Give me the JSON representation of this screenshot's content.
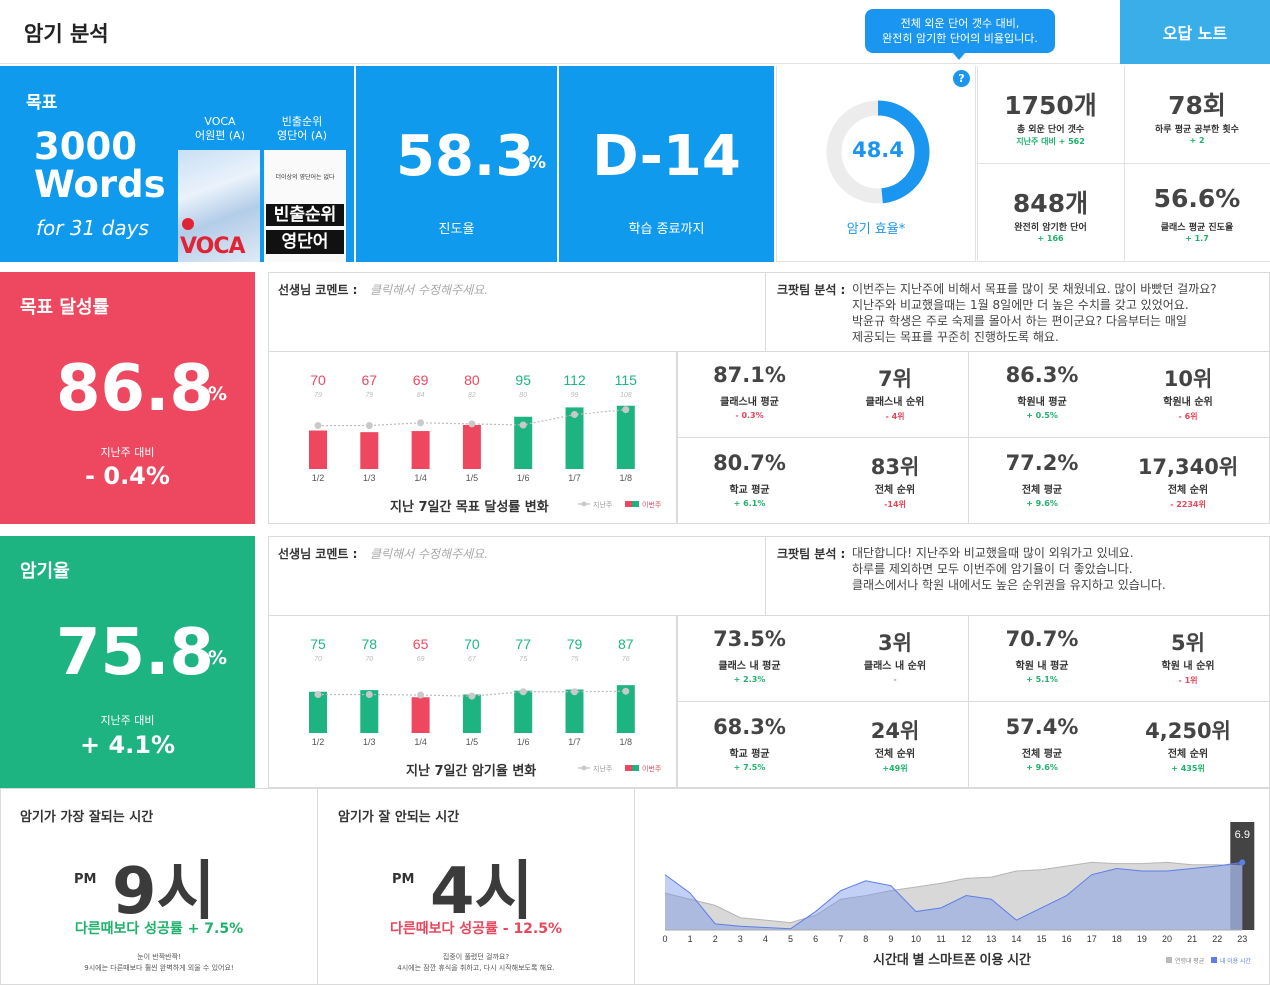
{
  "header": {
    "title": "암기 분석",
    "wrong_note_button": "오답 노트",
    "tooltip_line1": "전체 외운 단어 갯수 대비,",
    "tooltip_line2": "완전히 암기한 단어의 비율입니다.",
    "help_icon": "?"
  },
  "goal": {
    "label": "목표",
    "words": "3000 Words",
    "days": "for 31 days",
    "book1_caption_line1": "VOCA",
    "book1_caption_line2": "어원편 (A)",
    "book1_cover_text": "VOCA",
    "book2_caption_line1": "빈출순위",
    "book2_caption_line2": "영단어 (A)",
    "book2_cover_sub": "더이상의 영단어는 없다",
    "book2_cover_line1": "빈출순위",
    "book2_cover_line2": "영단어"
  },
  "progress": {
    "value": "58.3",
    "unit": "%",
    "label": "진도율"
  },
  "dday": {
    "value": "D-14",
    "label": "학습 종료까지"
  },
  "efficiency": {
    "value": "48.4",
    "percent": 48.4,
    "label": "암기 효율*"
  },
  "stats": [
    {
      "value": "1750개",
      "label": "총 외운 단어 갯수",
      "delta": "지난주 대비 + 562",
      "delta_color": "green"
    },
    {
      "value": "78회",
      "label": "하루 평균 공부한 횟수",
      "delta": "+ 2",
      "delta_color": "green"
    },
    {
      "value": "848개",
      "label": "완전히 암기한 단어",
      "delta": "+ 166",
      "delta_color": "green"
    },
    {
      "value": "56.6%",
      "label": "클래스 평균 진도율",
      "delta": "+ 1.7",
      "delta_color": "green"
    }
  ],
  "target": {
    "title": "목표 달성률",
    "value": "86.8",
    "unit": "%",
    "sub": "지난주 대비",
    "delta": "- 0.4%",
    "teacher_label": "선생님 코멘트 :",
    "teacher_placeholder": "클릭해서 수정해주세요.",
    "analysis_label": "크팟팀 분석 :",
    "analysis_lines": [
      "이번주는 지난주에 비해서 목표를 많이 못 채웠네요. 많이 바빴던 걸까요?",
      "지난주와 비교했을때는 1월 8일에만 더 높은 수치를 갖고 있었어요.",
      "박윤규 학생은 주로 숙제를 몰아서 하는 편이군요? 다음부터는 매일",
      "제공되는 목표를 꾸준히 진행하도록 해요."
    ],
    "chart_title": "지난 7일간 목표 달성률 변화",
    "legend_last": "지난주",
    "legend_this": "이번주",
    "grid": [
      {
        "value": "87.1%",
        "label": "클래스내 평균",
        "delta": "- 0.3%",
        "color": "red"
      },
      {
        "value": "7위",
        "label": "클래스내 순위",
        "delta": "- 4위",
        "color": "red"
      },
      {
        "value": "86.3%",
        "label": "학원내 평균",
        "delta": "+ 0.5%",
        "color": "green"
      },
      {
        "value": "10위",
        "label": "학원내 순위",
        "delta": "- 6위",
        "color": "red"
      },
      {
        "value": "80.7%",
        "label": "학교 평균",
        "delta": "+ 6.1%",
        "color": "green"
      },
      {
        "value": "83위",
        "label": "전체 순위",
        "delta": "-14위",
        "color": "red"
      },
      {
        "value": "77.2%",
        "label": "전체 평균",
        "delta": "+ 9.6%",
        "color": "green"
      },
      {
        "value": "17,340위",
        "label": "전체 순위",
        "delta": "- 2234위",
        "color": "red"
      }
    ]
  },
  "memory": {
    "title": "암기율",
    "value": "75.8",
    "unit": "%",
    "sub": "지난주 대비",
    "delta": "+ 4.1%",
    "teacher_label": "선생님 코멘트 :",
    "teacher_placeholder": "클릭해서 수정해주세요.",
    "analysis_label": "크팟팀 분석 :",
    "analysis_lines": [
      "대단합니다! 지난주와 비교했을때 많이 외워가고 있네요.",
      "하루를 제외하면 모두 이번주에 암기율이 더 좋았습니다.",
      "클래스에서나 학원 내에서도 높은 순위권을 유지하고 있습니다."
    ],
    "chart_title": "지난 7일간 암기율 변화",
    "legend_last": "지난주",
    "legend_this": "이번주",
    "grid": [
      {
        "value": "73.5%",
        "label": "클래스 내 평균",
        "delta": "+ 2.3%",
        "color": "green"
      },
      {
        "value": "3위",
        "label": "클래스 내 순위",
        "delta": "-",
        "color": "grey"
      },
      {
        "value": "70.7%",
        "label": "학원 내 평균",
        "delta": "+ 5.1%",
        "color": "green"
      },
      {
        "value": "5위",
        "label": "학원 내 순위",
        "delta": "- 1위",
        "color": "red"
      },
      {
        "value": "68.3%",
        "label": "학교 평균",
        "delta": "+ 7.5%",
        "color": "green"
      },
      {
        "value": "24위",
        "label": "전체 순위",
        "delta": "+49위",
        "color": "green"
      },
      {
        "value": "57.4%",
        "label": "전체 평균",
        "delta": "+ 9.6%",
        "color": "green"
      },
      {
        "value": "4,250위",
        "label": "전체 순위",
        "delta": "+ 435위",
        "color": "green"
      }
    ]
  },
  "best_time": {
    "title": "암기가 가장 잘되는 시간",
    "ampm": "PM",
    "hour": "9시",
    "rate": "다른때보다 성공률 + 7.5%",
    "note_line1": "눈이 반짝반짝!",
    "note_line2": "9시에는 다른때보다 훨씬 완벽하게 외울 수 있어요!"
  },
  "worst_time": {
    "title": "암기가 잘 안되는 시간",
    "ampm": "PM",
    "hour": "4시",
    "rate": "다른때보다 성공률 - 12.5%",
    "note_line1": "집중이 풀렸던 걸까요?",
    "note_line2": "4시에는 잠깐 휴식을 취하고, 다시 시작해보도록 해요."
  },
  "colors": {
    "blue": "#0f9aee",
    "red": "#ed4860",
    "green": "#1eb482",
    "tooltip": "#1a96f0",
    "button": "#3aaee8"
  },
  "chart_data": [
    {
      "type": "bar",
      "categories": [
        "1/2",
        "1/3",
        "1/4",
        "1/5",
        "1/6",
        "1/7",
        "1/8"
      ],
      "series": [
        {
          "name": "이번주",
          "values": [
            70,
            67,
            69,
            80,
            95,
            112,
            115
          ],
          "colors": [
            "red",
            "red",
            "red",
            "red",
            "green",
            "green",
            "green"
          ]
        },
        {
          "name": "지난주",
          "values": [
            79,
            79,
            84,
            82,
            80,
            99,
            108
          ]
        }
      ],
      "title": "지난 7일간 목표 달성률 변화",
      "ylim": [
        0,
        180
      ]
    },
    {
      "type": "bar",
      "categories": [
        "1/2",
        "1/3",
        "1/4",
        "1/5",
        "1/6",
        "1/7",
        "1/8"
      ],
      "series": [
        {
          "name": "이번주",
          "values": [
            75,
            78,
            65,
            70,
            77,
            79,
            87
          ],
          "colors": [
            "green",
            "green",
            "red",
            "green",
            "green",
            "green",
            "green"
          ]
        },
        {
          "name": "지난주",
          "values": [
            70,
            70,
            69,
            67,
            75,
            75,
            76
          ]
        }
      ],
      "title": "지난 7일간 암기율 변화",
      "ylim": [
        0,
        140
      ]
    },
    {
      "type": "area",
      "title": "시간대 별 스마트폰 이용 시간",
      "x": [
        0,
        1,
        2,
        3,
        4,
        5,
        6,
        7,
        8,
        9,
        10,
        11,
        12,
        13,
        14,
        15,
        16,
        17,
        18,
        19,
        20,
        21,
        22,
        23
      ],
      "series": [
        {
          "name": "연령대 평균",
          "color": "#c8c8c8",
          "values": [
            3.0,
            2.5,
            2.0,
            1.0,
            0.8,
            0.6,
            1.2,
            2.5,
            2.8,
            3.2,
            3.5,
            3.8,
            4.2,
            4.3,
            4.8,
            4.9,
            5.2,
            5.5,
            5.4,
            5.4,
            5.5,
            5.3,
            5.3,
            5.2
          ]
        },
        {
          "name": "내 이용 시간",
          "color": "#5b7fe6",
          "values": [
            4.5,
            3.0,
            0.5,
            0.3,
            0.2,
            0.1,
            1.5,
            3.2,
            4.0,
            3.6,
            1.5,
            1.8,
            2.8,
            2.5,
            0.8,
            1.8,
            2.8,
            4.5,
            5.0,
            4.8,
            4.8,
            5.0,
            5.2,
            5.5
          ]
        }
      ],
      "highlight": {
        "x": 23,
        "label": "6.9"
      },
      "legend": [
        "연령대 평균",
        "내 이용 시간"
      ]
    }
  ]
}
